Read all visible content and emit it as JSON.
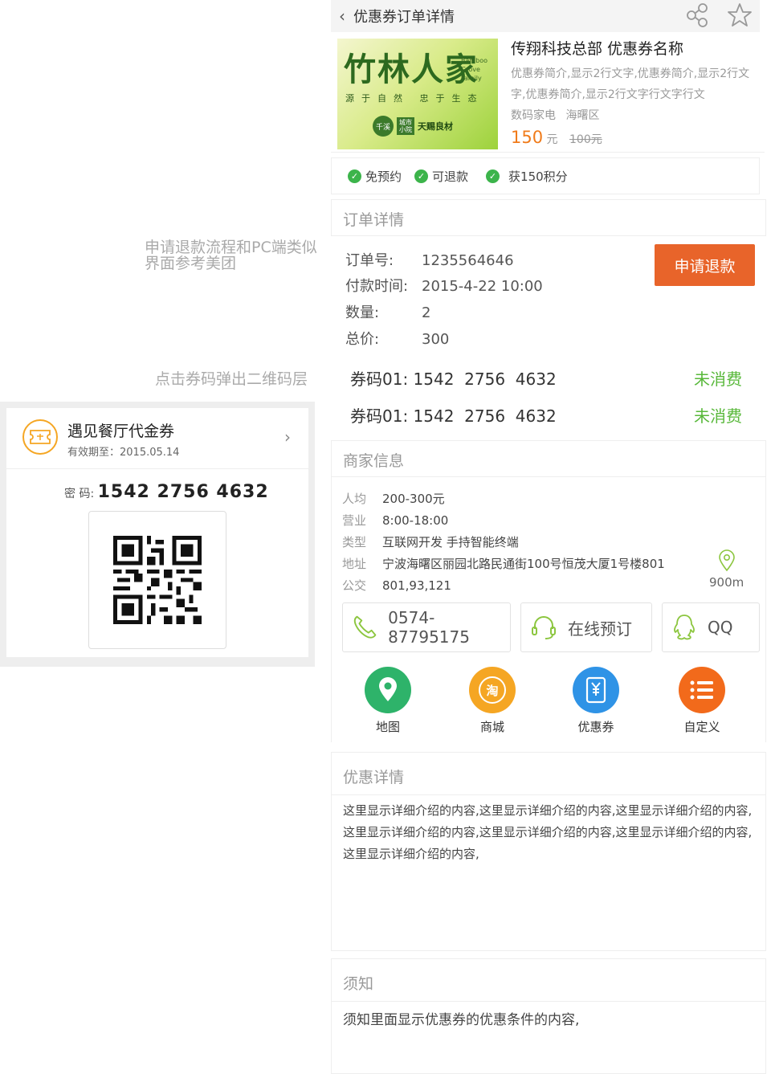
{
  "topbar": {
    "title": "优惠券订单详情",
    "back_icon": "chevron-left-icon"
  },
  "product": {
    "title": "传翔科技总部 优惠券名称",
    "desc": "优惠券简介,显示2行文字,优惠券简介,显示2行文字,优惠券简介,显示2行文字行文字行文",
    "category": "数码家电",
    "district": "海曙区",
    "price": "150",
    "unit": "元",
    "old_price": "100元",
    "logo": {
      "main": "竹林人家",
      "en": "Bamboo Grove Family",
      "slogan": "源于自然 忠于生态",
      "badge1": "千溪",
      "badge2": "城市小院",
      "brand": "天赐良材"
    }
  },
  "tags": [
    "免预约",
    "可退款",
    "获150积分"
  ],
  "order": {
    "section_title": "订单详情",
    "rows": [
      {
        "label": "订单号:",
        "value": "1235564646"
      },
      {
        "label": "付款时间:",
        "value": "2015-4-22 10:00"
      },
      {
        "label": "数量:",
        "value": "2"
      },
      {
        "label": "总价:",
        "value": "300"
      }
    ],
    "refund_label": "申请退款",
    "codes": [
      {
        "label": "券码01:",
        "code": "1542  2756  4632",
        "status": "未消费"
      },
      {
        "label": "券码01:",
        "code": "1542  2756  4632",
        "status": "未消费"
      }
    ]
  },
  "merchant": {
    "section_title": "商家信息",
    "rows": [
      {
        "label": "人均",
        "value": "200-300元"
      },
      {
        "label": "营业",
        "value": "8:00-18:00"
      },
      {
        "label": "类型",
        "value": "互联网开发 手持智能终端"
      },
      {
        "label": "地址",
        "value": "宁波海曙区丽园北路民通街100号恒茂大厦1号楼801"
      },
      {
        "label": "公交",
        "value": "801,93,121"
      }
    ],
    "distance": "900m",
    "phone": "0574-87795175",
    "online_booking": "在线预订",
    "qq": "QQ",
    "apps": [
      {
        "label": "地图",
        "color": "#2eb36a"
      },
      {
        "label": "商城",
        "color": "#f5a623"
      },
      {
        "label": "优惠券",
        "color": "#2f93e6"
      },
      {
        "label": "自定义",
        "color": "#f26a1b"
      }
    ]
  },
  "detail": {
    "section_title": "优惠详情",
    "text": "这里显示详细介绍的内容,这里显示详细介绍的内容,这里显示详细介绍的内容,这里显示详细介绍的内容,这里显示详细介绍的内容,这里显示详细介绍的内容,这里显示详细介绍的内容,"
  },
  "notice": {
    "section_title": "须知",
    "text": "须知里面显示优惠券的优惠条件的内容,"
  },
  "notes": {
    "refund_note_1": "申请退款流程和PC端类似",
    "refund_note_2": "界面参考美团",
    "qr_note": "点击券码弹出二维码层"
  },
  "popup": {
    "coupon_name": "遇见餐厅代金券",
    "expiry": "有效期至：2015.05.14",
    "code_label": "密 码:",
    "code": "1542  2756  4632"
  }
}
